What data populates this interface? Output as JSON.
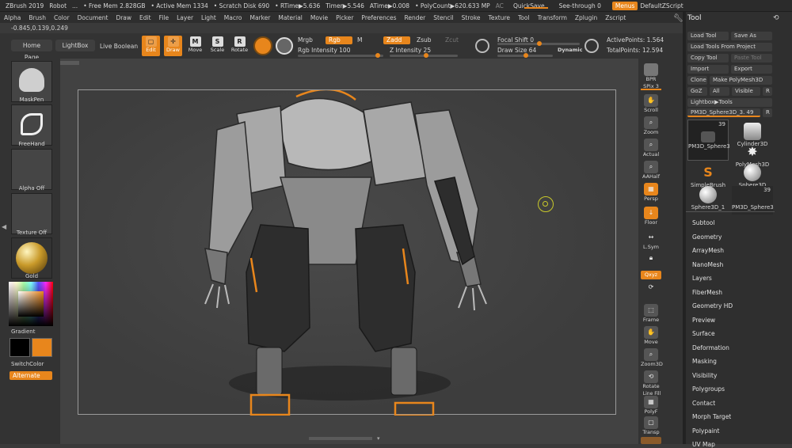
{
  "title_bar": {
    "app": "ZBrush 2019",
    "doc": "Robot",
    "sep": "...",
    "free_mem": "• Free Mem 2.828GB",
    "active_mem": "• Active Mem 1334",
    "scratch": "• Scratch Disk 690",
    "rtime": "• RTime▶5.636",
    "timer": "Timer▶5.546",
    "atime": "ATime▶0.008",
    "polycount": "• PolyCount▶620.633 MP",
    "ac": "AC",
    "quicksave": "QuickSave",
    "see_through": "See-through 0",
    "menus": "Menus",
    "default_zscript": "DefaultZScript"
  },
  "menubar": [
    "Alpha",
    "Brush",
    "Color",
    "Document",
    "Draw",
    "Edit",
    "File",
    "Layer",
    "Light",
    "Macro",
    "Marker",
    "Material",
    "Movie",
    "Picker",
    "Preferences",
    "Render",
    "Stencil",
    "Stroke",
    "Texture",
    "Tool",
    "Transform",
    "Zplugin",
    "Zscript"
  ],
  "coords": "-0.845,0.139,0.249",
  "shelf": {
    "home_page": "Home Page",
    "lightbox": "LightBox",
    "live_boolean": "Live Boolean",
    "edit": "Edit",
    "draw": "Draw",
    "move": "Move",
    "scale": "Scale",
    "rotate": "Rotate",
    "mrgb": "Mrgb",
    "rgb": "Rgb",
    "m": "M",
    "zadd": "Zadd",
    "zsub": "Zsub",
    "zcut": "Zcut",
    "rgb_intensity": "Rgb Intensity 100",
    "z_intensity": "Z Intensity 25",
    "focal_shift": "Focal Shift 0",
    "draw_size": "Draw Size 64",
    "dynamic": "Dynamic",
    "active_points": "ActivePoints: 1.564",
    "total_points": "TotalPoints: 12.594"
  },
  "left_shelf": {
    "brush": "MaskPen",
    "stroke": "FreeHand",
    "alpha": "Alpha Off",
    "texture": "Texture Off",
    "material": "Gold",
    "gradient": "Gradient",
    "switch_color": "SwitchColor",
    "alternate": "Alternate"
  },
  "right_shelf": {
    "bpr": "BPR",
    "spix": "SPix 3",
    "scroll": "Scroll",
    "zoom": "Zoom",
    "actual": "Actual",
    "aahalf": "AAHalf",
    "persp": "Persp",
    "floor": "Floor",
    "lsym": "L.Sym",
    "xyz": "Qxyz",
    "frame": "Frame",
    "move": "Move",
    "zoom3d": "Zoom3D",
    "rotate": "Rotate",
    "line_fill": "Line Fill",
    "polyf": "PolyF",
    "transp": "Transp"
  },
  "tool_panel": {
    "title": "Tool",
    "load_tool": "Load Tool",
    "save_as": "Save As",
    "load_from_project": "Load Tools From Project",
    "copy_tool": "Copy Tool",
    "paste_tool": "Paste Tool",
    "import": "Import",
    "export": "Export",
    "clone": "Clone",
    "make_polymesh": "Make PolyMesh3D",
    "goz": "GoZ",
    "all": "All",
    "visible": "Visible",
    "r": "R",
    "lightbox_tools": "Lightbox▶Tools",
    "current_tool": "PM3D_Sphere3D_3. 49",
    "meshes": [
      {
        "label": "PM3D_Sphere3",
        "count": "39"
      },
      {
        "label": "Cylinder3D",
        "count": ""
      },
      {
        "label": "PolyMesh3D",
        "count": ""
      },
      {
        "label": "SimpleBrush",
        "count": ""
      },
      {
        "label": "Sphere3D",
        "count": ""
      },
      {
        "label": "Sphere3D_1",
        "count": ""
      },
      {
        "label": "PM3D_Sphere3",
        "count": "39"
      }
    ],
    "sections": [
      "Subtool",
      "Geometry",
      "ArrayMesh",
      "NanoMesh",
      "Layers",
      "FiberMesh",
      "Geometry HD",
      "Preview",
      "Surface",
      "Deformation",
      "Masking",
      "Visibility",
      "Polygroups",
      "Contact",
      "Morph Target",
      "Polypaint",
      "UV Map"
    ]
  },
  "colors": {
    "accent": "#e8861c",
    "bg": "#3a3a3a"
  }
}
